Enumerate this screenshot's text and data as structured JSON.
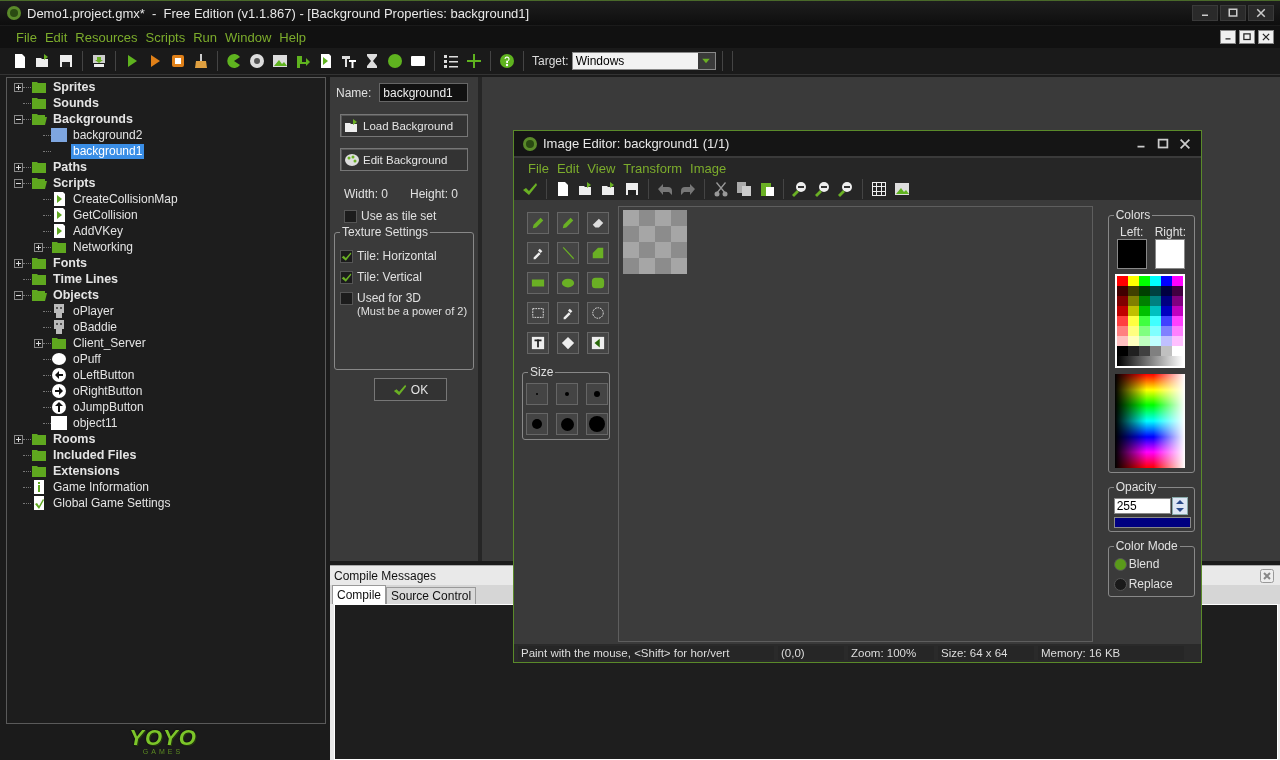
{
  "window": {
    "title": "Demo1.project.gmx*  -  Free Edition (v1.1.867) - [Background Properties: background1]"
  },
  "menu": [
    "File",
    "Edit",
    "Resources",
    "Scripts",
    "Run",
    "Window",
    "Help"
  ],
  "toolbar": {
    "target_label": "Target:",
    "target_value": "Windows"
  },
  "resource_tree": [
    {
      "label": "Sprites",
      "kind": "folder",
      "expanded": false,
      "selected": false
    },
    {
      "label": "Sounds",
      "kind": "folder",
      "selected": false
    },
    {
      "label": "Backgrounds",
      "kind": "folder",
      "expanded": true,
      "selected": false,
      "children": [
        {
          "label": "background2",
          "kind": "background",
          "selected": false
        },
        {
          "label": "background1",
          "kind": "blank",
          "selected": true
        }
      ]
    },
    {
      "label": "Paths",
      "kind": "folder",
      "expanded": false,
      "selected": false
    },
    {
      "label": "Scripts",
      "kind": "folder",
      "expanded": true,
      "selected": false,
      "children": [
        {
          "label": "CreateCollisionMap",
          "kind": "script",
          "selected": false
        },
        {
          "label": "GetCollision",
          "kind": "script",
          "selected": false
        },
        {
          "label": "AddVKey",
          "kind": "script",
          "selected": false
        },
        {
          "label": "Networking",
          "kind": "folder",
          "expanded": false,
          "selected": false
        }
      ]
    },
    {
      "label": "Fonts",
      "kind": "folder",
      "expanded": false,
      "selected": false
    },
    {
      "label": "Time Lines",
      "kind": "folder",
      "selected": false
    },
    {
      "label": "Objects",
      "kind": "folder",
      "expanded": true,
      "selected": false,
      "children": [
        {
          "label": "oPlayer",
          "kind": "robot",
          "selected": false
        },
        {
          "label": "oBaddie",
          "kind": "robot",
          "selected": false
        },
        {
          "label": "Client_Server",
          "kind": "folder",
          "expanded": false,
          "selected": false
        },
        {
          "label": "oPuff",
          "kind": "blob",
          "selected": false
        },
        {
          "label": "oLeftButton",
          "kind": "arrow_left",
          "selected": false
        },
        {
          "label": "oRightButton",
          "kind": "arrow_right",
          "selected": false
        },
        {
          "label": "oJumpButton",
          "kind": "arrow_up",
          "selected": false
        },
        {
          "label": "object11",
          "kind": "square",
          "selected": false
        }
      ]
    },
    {
      "label": "Rooms",
      "kind": "folder",
      "expanded": false,
      "selected": false
    },
    {
      "label": "Included Files",
      "kind": "folder",
      "selected": false
    },
    {
      "label": "Extensions",
      "kind": "folder",
      "selected": false
    },
    {
      "label": "Game Information",
      "kind": "info",
      "selected": false
    },
    {
      "label": "Global Game Settings",
      "kind": "settings",
      "selected": false
    }
  ],
  "logo": {
    "name": "YOYO",
    "tagline": "GAMES"
  },
  "background_properties": {
    "name_label": "Name:",
    "name_value": "background1",
    "buttons": [
      {
        "label": "Load Background",
        "kind": "load"
      },
      {
        "label": "Edit Background",
        "kind": "edit"
      }
    ],
    "width": "Width: 0",
    "height": "Height: 0",
    "tile_set": {
      "label": "Use as tile set",
      "checked": false
    },
    "texture_settings": {
      "title": "Texture Settings",
      "options": [
        {
          "label": "Tile: Horizontal",
          "checked": true
        },
        {
          "label": "Tile: Vertical",
          "checked": true
        },
        {
          "label": "Used for 3D",
          "note": "(Must be a power of 2)",
          "checked": false
        }
      ]
    },
    "ok": "OK"
  },
  "image_editor": {
    "title": "Image Editor: background1 (1/1)",
    "menu": [
      "File",
      "Edit",
      "View",
      "Transform",
      "Image"
    ],
    "size_title": "Size",
    "colors": {
      "title": "Colors",
      "swatches": [
        {
          "label": "Left:",
          "color": "#000000"
        },
        {
          "label": "Right:",
          "color": "#ffffff"
        }
      ]
    },
    "opacity": {
      "title": "Opacity",
      "value": "255"
    },
    "color_mode": {
      "title": "Color Mode",
      "options": [
        {
          "label": "Blend",
          "selected": true
        },
        {
          "label": "Replace",
          "selected": false
        }
      ]
    },
    "status": [
      "Paint with the mouse, <Shift> for hor/vert",
      "(0,0)",
      "Zoom: 100%",
      "Size: 64 x 64",
      "Memory: 16 KB"
    ]
  },
  "compile_messages": {
    "title": "Compile Messages",
    "tabs": [
      {
        "label": "Compile",
        "selected": true
      },
      {
        "label": "Source Control",
        "selected": false
      }
    ]
  }
}
